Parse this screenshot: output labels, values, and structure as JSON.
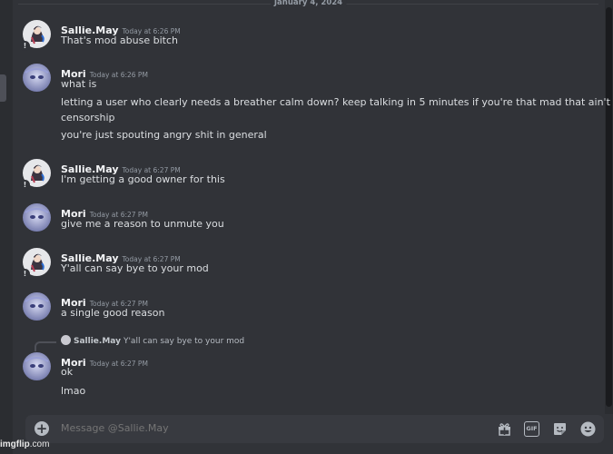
{
  "date_divider": "January 4, 2024",
  "messages": [
    {
      "author": "Sallie.May",
      "timestamp": "Today at 6:26 PM",
      "avatar": "sallie",
      "lines": [
        "That's mod abuse bitch"
      ]
    },
    {
      "author": "Mori",
      "timestamp": "Today at 6:26 PM",
      "avatar": "mori",
      "lines": [
        "what is",
        "letting a user who clearly needs a breather calm down? keep talking in 5 minutes if you're that mad that ain't",
        "censorship",
        "you're just spouting angry shit in general"
      ]
    },
    {
      "author": "Sallie.May",
      "timestamp": "Today at 6:27 PM",
      "avatar": "sallie",
      "lines": [
        "I'm getting a good owner for this"
      ]
    },
    {
      "author": "Mori",
      "timestamp": "Today at 6:27 PM",
      "avatar": "mori",
      "lines": [
        "give me a reason to unmute you"
      ]
    },
    {
      "author": "Sallie.May",
      "timestamp": "Today at 6:27 PM",
      "avatar": "sallie",
      "lines": [
        "Y'all can say bye to your mod"
      ]
    },
    {
      "author": "Mori",
      "timestamp": "Today at 6:27 PM",
      "avatar": "mori",
      "lines": [
        "a single good reason"
      ]
    },
    {
      "author": "Mori",
      "timestamp": "Today at 6:27 PM",
      "avatar": "mori",
      "lines": [
        "ok",
        "lmao"
      ]
    }
  ],
  "reply": {
    "author": "Sallie.May",
    "text": "Y'all can say bye to your mod"
  },
  "composer": {
    "placeholder": "Message @Sallie.May"
  },
  "toolbar_icons": [
    "gift-icon",
    "gif-icon",
    "sticker-icon",
    "emoji-icon"
  ],
  "badge": "!",
  "watermark": {
    "brand": "imgflip",
    "suffix": ".com"
  },
  "colors": {
    "background": "#313338",
    "text": "#dbdee1",
    "muted": "#949ba4",
    "input": "#383a40"
  }
}
